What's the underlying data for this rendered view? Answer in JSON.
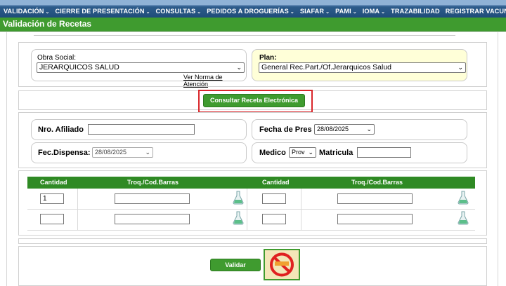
{
  "nav": {
    "items": [
      {
        "label": "VALIDACIÓN",
        "caret": true
      },
      {
        "label": "CIERRE DE PRESENTACIÓN",
        "caret": true
      },
      {
        "label": "CONSULTAS",
        "caret": true
      },
      {
        "label": "PEDIDOS A DROGUERÍAS",
        "caret": true
      },
      {
        "label": "SIAFAR",
        "caret": true
      },
      {
        "label": "PAMI",
        "caret": true
      },
      {
        "label": "IOMA",
        "caret": true
      },
      {
        "label": "TRAZABILIDAD",
        "caret": false
      },
      {
        "label": "REGISTRAR VACUNACION",
        "caret": false
      }
    ]
  },
  "page": {
    "title": "Validación de Recetas"
  },
  "obra_social": {
    "label": "Obra Social:",
    "value": "JERARQUICOS SALUD",
    "link": "Ver Norma de Atención"
  },
  "plan": {
    "label": "Plan:",
    "value": "General Rec.Part./Of.Jerarquicos Salud"
  },
  "consult_button": "Consultar Receta Electrónica",
  "form": {
    "afiliado_label": "Nro. Afiliado",
    "afiliado_value": "",
    "fecha_pres_label": "Fecha de Pres",
    "fecha_pres_value": "28/08/2025",
    "fec_dispensa_label": "Fec.Dispensa:",
    "fec_dispensa_value": "28/08/2025",
    "medico_label": "Medico",
    "medico_value": "Prov",
    "matricula_label": "Matricula",
    "matricula_value": ""
  },
  "table": {
    "headers": [
      "Cantidad",
      "Troq./Cod.Barras",
      "Cantidad",
      "Troq./Cod.Barras"
    ],
    "rows": [
      {
        "qty1": "1",
        "code1": "",
        "qty2": "",
        "code2": ""
      },
      {
        "qty1": "",
        "code1": "",
        "qty2": "",
        "code2": ""
      }
    ]
  },
  "validate_button": "Validar",
  "colors": {
    "nav": "#1f4c7a",
    "green": "#3f9b2f",
    "highlight": "#d9262b",
    "plan_bg": "#ffffd8"
  }
}
